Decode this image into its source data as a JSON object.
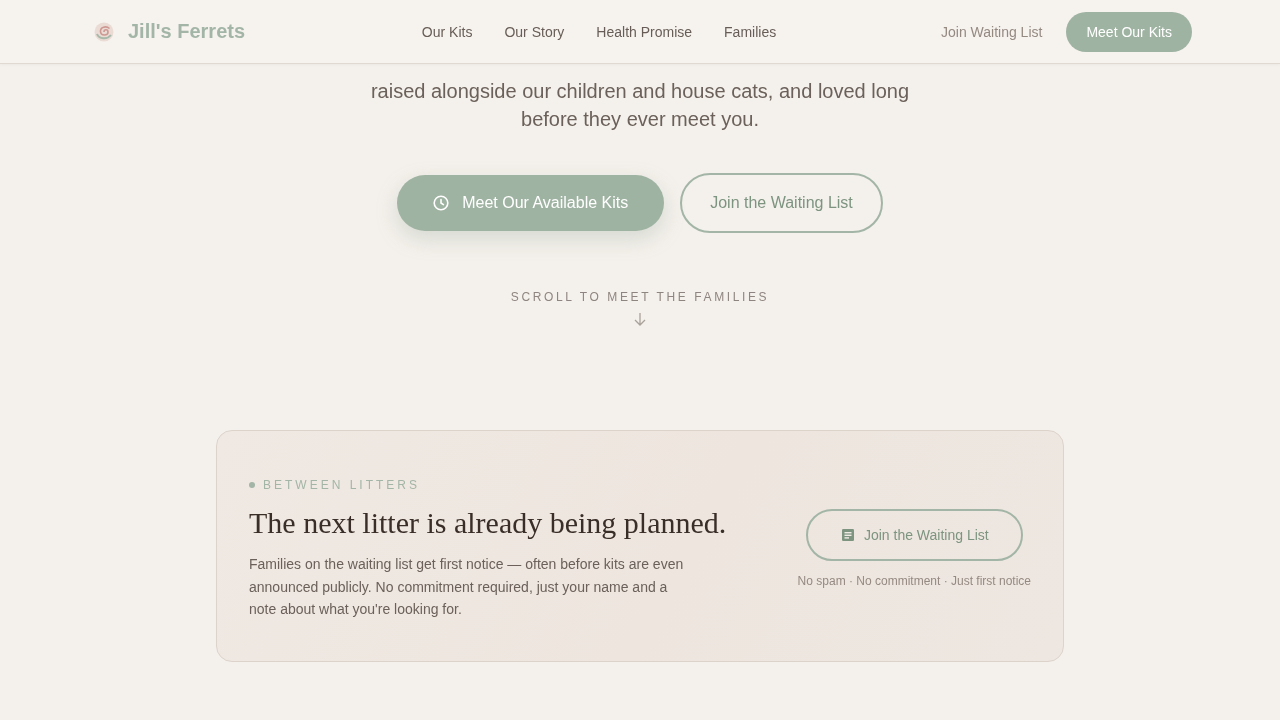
{
  "header": {
    "brand": "Jill's Ferrets",
    "nav": [
      "Our Kits",
      "Our Story",
      "Health Promise",
      "Families"
    ],
    "secondary_link": "Join Waiting List",
    "cta_button": "Meet Our Kits"
  },
  "hero": {
    "intro": "raised alongside our children and house cats, and loved long before they ever meet you.",
    "primary_button": "Meet Our Available Kits",
    "secondary_button": "Join the Waiting List",
    "scroll_hint": "SCROLL TO MEET THE FAMILIES"
  },
  "waitlist_card": {
    "eyebrow": "BETWEEN LITTERS",
    "title": "The next litter is already being planned.",
    "text": "Families on the waiting list get first notice — often before kits are even announced publicly. No commitment required, just your name and a note about what you're looking for.",
    "button": "Join the Waiting List",
    "note": "No spam · No commitment · Just first notice"
  }
}
